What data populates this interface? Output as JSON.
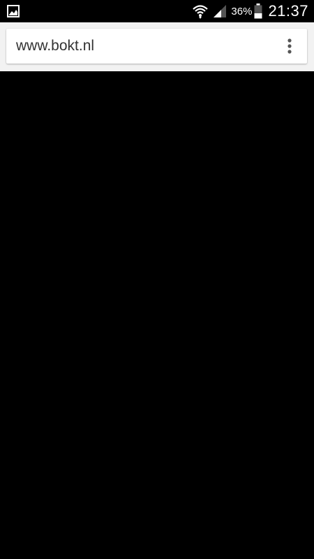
{
  "status_bar": {
    "notification_icon": "image-icon",
    "wifi_icon": "wifi-icon",
    "signal_icon": "signal-icon",
    "battery_percent": "36%",
    "battery_icon": "battery-icon",
    "time": "21:37"
  },
  "browser": {
    "url": "www.bokt.nl",
    "menu_icon": "more-vert-icon"
  },
  "colors": {
    "status_bar_bg": "#000000",
    "toolbar_bg": "#f2f2f2",
    "omnibox_bg": "#ffffff",
    "content_bg": "#000000"
  }
}
